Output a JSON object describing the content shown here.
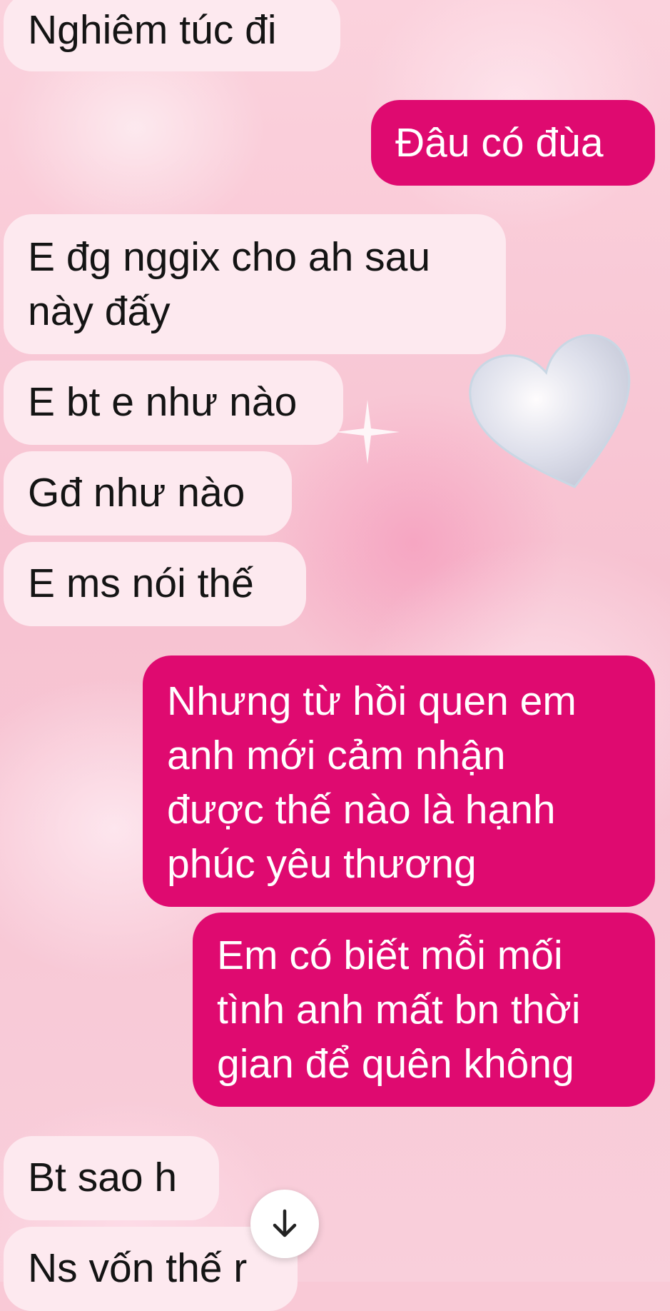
{
  "messages": [
    {
      "side": "incoming",
      "lines": [
        "Nghiêm túc đi"
      ]
    },
    {
      "side": "outgoing",
      "lines": [
        "Đâu có đùa"
      ]
    },
    {
      "side": "incoming",
      "lines": [
        "E đg nggix cho ah sau",
        "này đấy"
      ]
    },
    {
      "side": "incoming",
      "lines": [
        "E bt e như nào"
      ]
    },
    {
      "side": "incoming",
      "lines": [
        "Gđ như nào"
      ]
    },
    {
      "side": "incoming",
      "lines": [
        "E ms nói thế"
      ]
    },
    {
      "side": "outgoing",
      "lines": [
        "Nhưng từ hồi quen em",
        "anh mới cảm nhận",
        "được thế nào là hạnh",
        "phúc yêu thương"
      ]
    },
    {
      "side": "outgoing",
      "lines": [
        "Em có biết mỗi mối",
        "tình anh mất bn thời",
        "gian để quên không"
      ]
    },
    {
      "side": "incoming",
      "lines": [
        "Bt sao h"
      ]
    },
    {
      "side": "incoming",
      "lines": [
        "Ns vốn thế r"
      ]
    }
  ],
  "scroll_button": {
    "icon": "arrow-down-icon",
    "glyph": "↓"
  },
  "colors": {
    "incoming_bubble": "#fde9ef",
    "outgoing_bubble": "#df0a70",
    "incoming_text": "#141414",
    "outgoing_text": "#ffffff"
  }
}
